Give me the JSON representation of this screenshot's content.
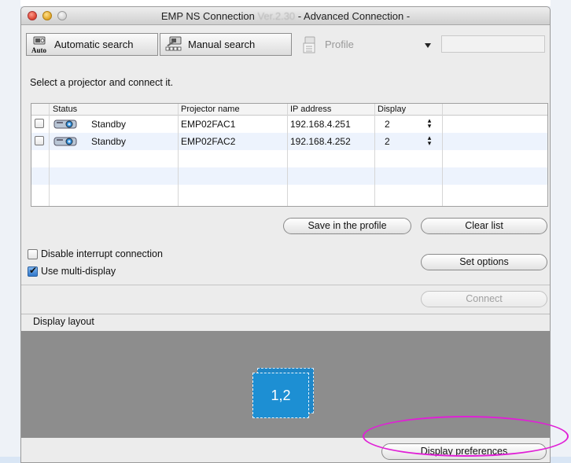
{
  "window": {
    "title_main": "EMP NS Connection",
    "title_version": "Ver.2.30",
    "title_sub": " - Advanced Connection -"
  },
  "toolbar": {
    "auto_search": "Automatic search",
    "auto_icon_label": "Auto",
    "manual_search": "Manual search",
    "profile": "Profile"
  },
  "instruction": "Select a projector and connect it.",
  "table": {
    "headers": [
      "Status",
      "Projector name",
      "IP address",
      "Display"
    ],
    "rows": [
      {
        "status": "Standby",
        "name": "EMP02FAC1",
        "ip": "192.168.4.251",
        "display": "2"
      },
      {
        "status": "Standby",
        "name": "EMP02FAC2",
        "ip": "192.168.4.252",
        "display": "2"
      }
    ]
  },
  "buttons": {
    "save_profile": "Save in the profile",
    "clear_list": "Clear list",
    "set_options": "Set options",
    "connect": "Connect",
    "display_preferences": "Display preferences"
  },
  "options": {
    "disable_interrupt": "Disable interrupt connection",
    "disable_interrupt_checked": false,
    "use_multi_display": "Use multi-display",
    "use_multi_display_checked": true
  },
  "display_layout": {
    "label": "Display layout",
    "screen_label": "1,2"
  },
  "colors": {
    "highlight": "#e020d6",
    "display_tile": "#1d8fd3",
    "layout_bg": "#8d8d8d",
    "row_alt": "#edf3fd"
  }
}
